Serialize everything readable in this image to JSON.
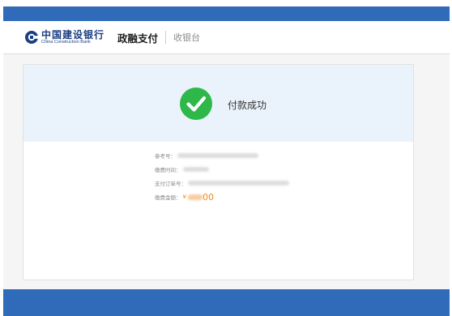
{
  "header": {
    "bank_name_cn": "中国建设银行",
    "bank_name_en": "China Construction Bank",
    "brand": "政融支付",
    "subtitle": "收银台"
  },
  "colors": {
    "top_bar": "#2f6bb8",
    "bank_blue": "#1a3f82",
    "success_green": "#2eb84a",
    "success_band": "#eaf3fb",
    "amount_orange": "#f08a1c"
  },
  "status": {
    "icon": "check-circle-icon",
    "text": "付款成功"
  },
  "details": {
    "reference_label": "参考号：",
    "pay_time_label": "缴费时间：",
    "order_no_label": "支付订单号：",
    "amount_label": "缴费金额：",
    "amount_prefix": "¥",
    "amount_suffix": "00"
  }
}
